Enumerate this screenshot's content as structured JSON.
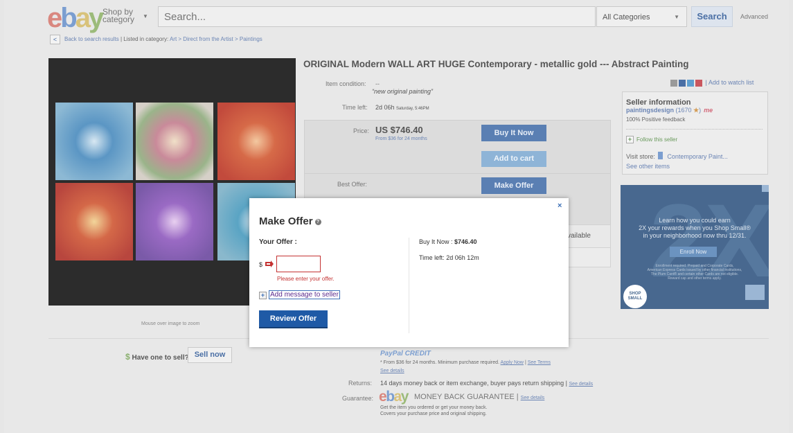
{
  "header": {
    "logo": [
      "e",
      "b",
      "a",
      "y"
    ],
    "shop_by_line1": "Shop by",
    "shop_by_line2": "category",
    "search_placeholder": "Search...",
    "category_select": "All Categories",
    "search_button": "Search",
    "advanced": "Advanced"
  },
  "breadcrumb": {
    "back": "Back to search results",
    "listed_in": "| Listed in category:",
    "path": "Art > Direct from the Artist > Paintings"
  },
  "item": {
    "title": "ORIGINAL Modern WALL ART HUGE Contemporary - metallic gold --- Abstract Painting",
    "condition_label": "Item condition:",
    "condition_value": "--",
    "condition_quote": "“new original painting”",
    "time_left_label": "Time left:",
    "time_left_value": "2d 06h",
    "time_left_detail": "Saturday, 5:46PM",
    "price_label": "Price:",
    "price_value": "US $746.40",
    "price_financing": "From $36 for 24 months",
    "buy_now": "Buy It Now",
    "add_to_cart": "Add to cart",
    "best_offer_label": "Best Offer:",
    "make_offer": "Make Offer",
    "available_text": "vailable",
    "zoom_note": "Mouse over image to zoom"
  },
  "social": {
    "watch_list": "| Add to watch list",
    "colors": [
      "#9a9a9a",
      "#4a6fa5",
      "#5f9fd0",
      "#c9575f"
    ]
  },
  "seller": {
    "title": "Seller information",
    "name": "paintingsdesign",
    "score": "(1670",
    "score_close": ")",
    "me": "me",
    "feedback": "100% Positive feedback",
    "follow": "Follow this seller",
    "visit_label": "Visit store:",
    "store_name": "Contemporary Paint...",
    "see_other": "See other items"
  },
  "ad": {
    "big_text": "2X",
    "headline_line1": "Learn how you could earn",
    "headline_line2": "2X your rewards when you Shop Small®",
    "headline_line3": "in your neighborhood now thru 12/31.",
    "enroll": "Enroll Now",
    "fine_line1": "Enrollment required. Prepaid and Corporate Cards,",
    "fine_line2": "American Express Cards issued by other financial institutions,",
    "fine_line3": "The Plum Card® and certain other Cards are not eligible.",
    "fine_line4": "Reward cap and other terms apply.",
    "shop_small_line1": "SHOP",
    "shop_small_line2": "SMALL"
  },
  "lower": {
    "have_one": "Have one to sell?",
    "sell_now": "Sell now",
    "paypal": "PayPal CREDIT",
    "paypal_note": "* From $36 for 24 months. Minimum purchase required.",
    "apply_now": "Apply Now",
    "see_terms": "See Terms",
    "see_details": "See details",
    "returns_label": "Returns:",
    "returns_value": "14 days money back or item exchange, buyer pays return shipping |",
    "guarantee_label": "Guarantee:",
    "guarantee_text": "MONEY BACK GUARANTEE",
    "guarantee_sub1": "Get the item you ordered or get your money back.",
    "guarantee_sub2": "Covers your purchase price and original shipping."
  },
  "modal": {
    "close": "×",
    "title": "Make Offer",
    "help": "?",
    "your_offer": "Your Offer :",
    "currency": "$",
    "offer_value": "",
    "error": "Please enter your offer.",
    "add_message": "Add message to seller",
    "review": "Review Offer",
    "bin_label": "Buy It Now :",
    "bin_value": "$746.40",
    "time_label": "Time left:",
    "time_value": "2d 06h 12m"
  }
}
